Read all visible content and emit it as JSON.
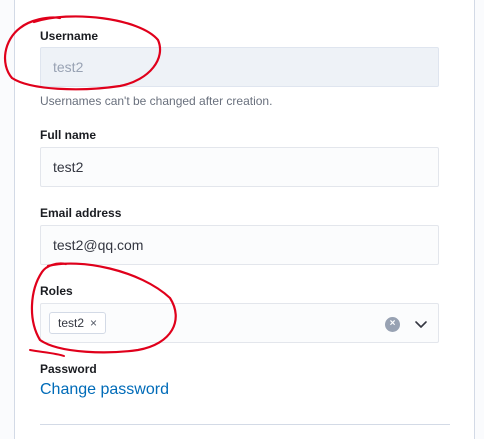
{
  "form": {
    "username": {
      "label": "Username",
      "value": "test2",
      "help": "Usernames can't be changed after creation."
    },
    "full_name": {
      "label": "Full name",
      "value": "test2"
    },
    "email": {
      "label": "Email address",
      "value": "test2@qq.com"
    },
    "roles": {
      "label": "Roles",
      "selected": [
        "test2"
      ],
      "remove_glyph": "×",
      "clear_glyph": "×"
    },
    "password": {
      "label": "Password",
      "link": "Change password"
    }
  },
  "colors": {
    "link": "#006bb8",
    "annotation": "#e0001b"
  }
}
